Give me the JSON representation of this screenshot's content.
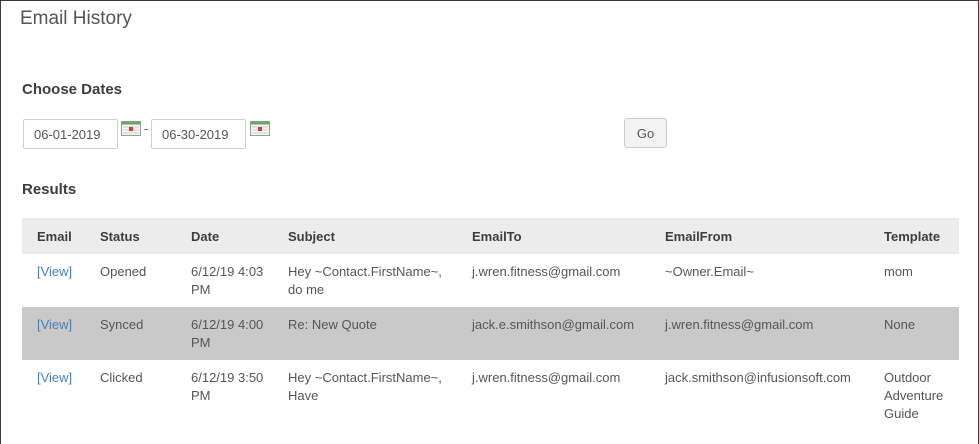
{
  "page": {
    "title": "Email History"
  },
  "filters": {
    "heading": "Choose Dates",
    "start_date": "06-01-2019",
    "end_date": "06-30-2019",
    "separator": "-",
    "go_label": "Go"
  },
  "results": {
    "heading": "Results",
    "columns": [
      "Email",
      "Status",
      "Date",
      "Subject",
      "EmailTo",
      "EmailFrom",
      "Template"
    ],
    "rows": [
      {
        "email": "[View]",
        "status": "Opened",
        "date": "6/12/19 4:03 PM",
        "subject": "Hey ~Contact.FirstName~, do me",
        "email_to": "j.wren.fitness@gmail.com",
        "email_from": "~Owner.Email~",
        "template": "mom"
      },
      {
        "email": "[View]",
        "status": "Synced",
        "date": "6/12/19 4:00 PM",
        "subject": "Re: New Quote",
        "email_to": "jack.e.smithson@gmail.com",
        "email_from": "j.wren.fitness@gmail.com",
        "template": "None"
      },
      {
        "email": "[View]",
        "status": "Clicked",
        "date": "6/12/19 3:50 PM",
        "subject": "Hey ~Contact.FirstName~, Have",
        "email_to": "j.wren.fitness@gmail.com",
        "email_from": "jack.smithson@infusionsoft.com",
        "template": "Outdoor Adventure Guide"
      }
    ]
  },
  "icons": {
    "calendar": "calendar-icon"
  },
  "colors": {
    "link": "#4a7fb0",
    "header_bg": "#ececec",
    "highlight_row": "#c9c9c9"
  }
}
